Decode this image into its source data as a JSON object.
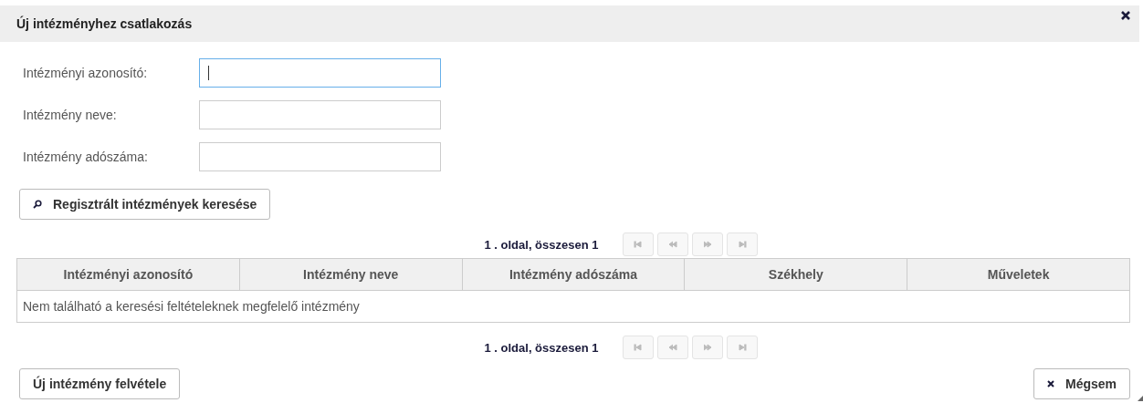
{
  "dialog": {
    "title": "Új intézményhez csatlakozás"
  },
  "fields": [
    {
      "label": "Intézményi azonosító:",
      "focused": true
    },
    {
      "label": "Intézmény neve:",
      "focused": false
    },
    {
      "label": "Intézmény adószáma:",
      "focused": false
    }
  ],
  "search_button": "Regisztrált intézmények keresése",
  "pager_top": {
    "text": "1 . oldal, összesen 1",
    "disabled": true
  },
  "table": {
    "columns": [
      "Intézményi azonosító",
      "Intézmény neve",
      "Intézmény adószáma",
      "Székhely",
      "Műveletek"
    ],
    "empty_message": "Nem található a keresési feltételeknek megfelelő intézmény"
  },
  "pager_bottom": {
    "text": "1 . oldal, összesen 1",
    "disabled": true
  },
  "buttons": {
    "add": "Új intézmény felvétele",
    "cancel": "Mégsem"
  }
}
